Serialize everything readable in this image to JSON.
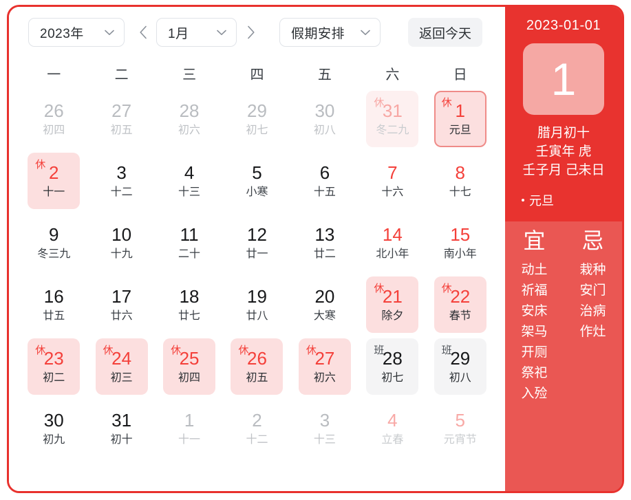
{
  "toolbar": {
    "year_label": "2023年",
    "month_label": "1月",
    "holiday_label": "假期安排",
    "today_label": "返回今天",
    "prev_icon": "chevron-left-icon",
    "next_icon": "chevron-right-icon",
    "dropdown_icon": "chevron-down-icon"
  },
  "weekdays": [
    "一",
    "二",
    "三",
    "四",
    "五",
    "六",
    "日"
  ],
  "days": [
    {
      "num": "26",
      "lunar": "初四",
      "other": true
    },
    {
      "num": "27",
      "lunar": "初五",
      "other": true
    },
    {
      "num": "28",
      "lunar": "初六",
      "other": true
    },
    {
      "num": "29",
      "lunar": "初七",
      "other": true
    },
    {
      "num": "30",
      "lunar": "初八",
      "other": true
    },
    {
      "num": "31",
      "lunar": "冬二九",
      "other": true,
      "holiday": true,
      "badge": "休"
    },
    {
      "num": "1",
      "lunar": "元旦",
      "holiday": true,
      "badge": "休",
      "selected": true
    },
    {
      "num": "2",
      "lunar": "十一",
      "holiday": true,
      "badge": "休"
    },
    {
      "num": "3",
      "lunar": "十二"
    },
    {
      "num": "4",
      "lunar": "十三"
    },
    {
      "num": "5",
      "lunar": "小寒"
    },
    {
      "num": "6",
      "lunar": "十五"
    },
    {
      "num": "7",
      "lunar": "十六",
      "weekend": true
    },
    {
      "num": "8",
      "lunar": "十七",
      "weekend": true
    },
    {
      "num": "9",
      "lunar": "冬三九"
    },
    {
      "num": "10",
      "lunar": "十九"
    },
    {
      "num": "11",
      "lunar": "二十"
    },
    {
      "num": "12",
      "lunar": "廿一"
    },
    {
      "num": "13",
      "lunar": "廿二"
    },
    {
      "num": "14",
      "lunar": "北小年",
      "weekend": true
    },
    {
      "num": "15",
      "lunar": "南小年",
      "weekend": true
    },
    {
      "num": "16",
      "lunar": "廿五"
    },
    {
      "num": "17",
      "lunar": "廿六"
    },
    {
      "num": "18",
      "lunar": "廿七"
    },
    {
      "num": "19",
      "lunar": "廿八"
    },
    {
      "num": "20",
      "lunar": "大寒"
    },
    {
      "num": "21",
      "lunar": "除夕",
      "holiday": true,
      "badge": "休"
    },
    {
      "num": "22",
      "lunar": "春节",
      "holiday": true,
      "badge": "休"
    },
    {
      "num": "23",
      "lunar": "初二",
      "holiday": true,
      "badge": "休"
    },
    {
      "num": "24",
      "lunar": "初三",
      "holiday": true,
      "badge": "休"
    },
    {
      "num": "25",
      "lunar": "初四",
      "holiday": true,
      "badge": "休"
    },
    {
      "num": "26",
      "lunar": "初五",
      "holiday": true,
      "badge": "休"
    },
    {
      "num": "27",
      "lunar": "初六",
      "holiday": true,
      "badge": "休"
    },
    {
      "num": "28",
      "lunar": "初七",
      "workday": true,
      "badge": "班"
    },
    {
      "num": "29",
      "lunar": "初八",
      "workday": true,
      "badge": "班"
    },
    {
      "num": "30",
      "lunar": "初九"
    },
    {
      "num": "31",
      "lunar": "初十"
    },
    {
      "num": "1",
      "lunar": "十一",
      "other": true
    },
    {
      "num": "2",
      "lunar": "十二",
      "other": true
    },
    {
      "num": "3",
      "lunar": "十三",
      "other": true
    },
    {
      "num": "4",
      "lunar": "立春",
      "other": true,
      "weekend": true
    },
    {
      "num": "5",
      "lunar": "元宵节",
      "other": true,
      "weekend": true
    }
  ],
  "sidebar": {
    "date": "2023-01-01",
    "big_day": "1",
    "lunar_day": "腊月初十",
    "ganzhi_year": "壬寅年 虎",
    "ganzhi_month_day": "壬子月 己未日",
    "festival": "元旦",
    "yi": {
      "title": "宜",
      "items": [
        "动土",
        "祈福",
        "安床",
        "架马",
        "开厕",
        "祭祀",
        "入殓"
      ]
    },
    "ji": {
      "title": "忌",
      "items": [
        "栽种",
        "安门",
        "治病",
        "作灶"
      ]
    }
  },
  "colors": {
    "brand_red": "#e8332f",
    "soft_red": "#ea5753",
    "accent_red": "#f4403a",
    "holiday_bg": "#fcdfdf",
    "holiday_bg_faded": "#fdf0f0",
    "workday_bg": "#f4f4f5",
    "selected_border": "#ef8b88",
    "big_day_bg": "#f5a8a4"
  }
}
